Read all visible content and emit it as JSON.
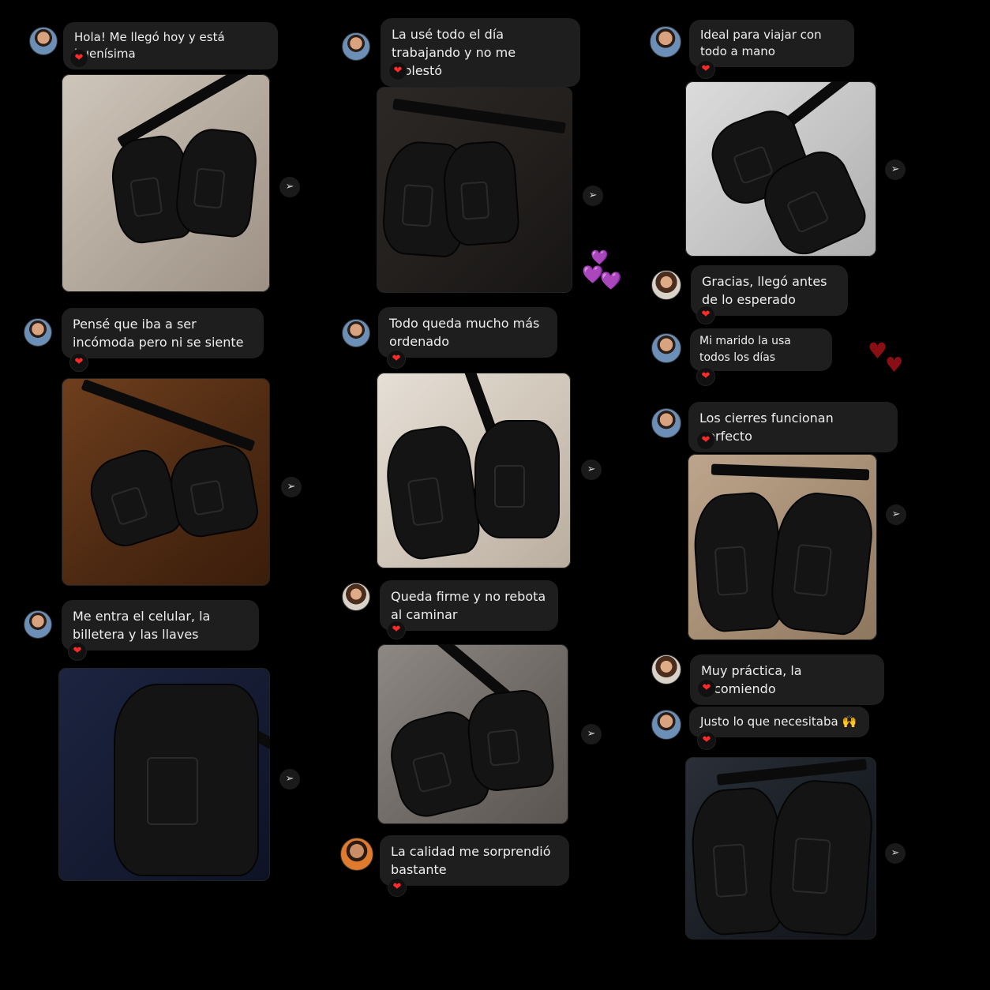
{
  "colors": {
    "background": "#000000",
    "bubble": "#1e1e1e",
    "reaction_heart": "#ff2a2a",
    "purple_heart": "#a77bd6",
    "dark_red_heart": "#8a0f14"
  },
  "reaction": {
    "icon": "red-heart-icon",
    "glyph": "❤"
  },
  "share": {
    "icon": "send-icon",
    "glyph": "➢"
  },
  "left_column": [
    {
      "text": "Hola! Me llegó hoy y está buenísima",
      "photo": "beige-bedsheet-bags"
    },
    {
      "text": "Pensé que iba a ser incómoda pero ni se siente",
      "photo": "wood-table-bags"
    },
    {
      "text": "Me entra el celular, la billetera y las llaves",
      "photo": "navy-cloth-bag"
    }
  ],
  "middle_column": [
    {
      "text": "La usé todo el día trabajando y no me molestó",
      "photo": "dark-quilt-bags"
    },
    {
      "text": "Todo queda mucho más ordenado",
      "photo": "tile-floor-bags"
    },
    {
      "text": "Queda firme y no rebota al caminar",
      "photo": "grey-sheet-bags"
    },
    {
      "text": "La calidad me sorprendió bastante"
    }
  ],
  "right_column": [
    {
      "text": "Ideal para viajar con todo a mano",
      "photo": "white-blanket-bags"
    },
    {
      "text": "Gracias, llegó antes de lo esperado"
    },
    {
      "text": "Mi marido la usa todos los días"
    },
    {
      "text": "Los cierres funcionan perfecto",
      "photo": "tan-carpet-bags"
    },
    {
      "text": "Muy práctica, la recomiendo"
    },
    {
      "text": "Justo lo que necesitaba 🙌",
      "photo": "black-leather-seat-bags"
    }
  ],
  "decorations": {
    "purple_hearts": "💜",
    "red_hearts": "♥"
  }
}
